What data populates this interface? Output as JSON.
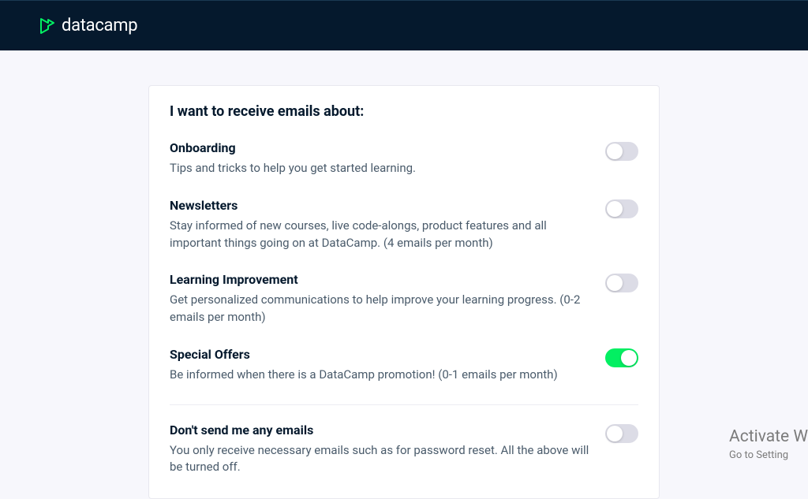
{
  "header": {
    "brand": "datacamp"
  },
  "card": {
    "title": "I want to receive emails about:"
  },
  "prefs": [
    {
      "label": "Onboarding",
      "desc": "Tips and tricks to help you get started learning.",
      "on": false
    },
    {
      "label": "Newsletters",
      "desc": "Stay informed of new courses, live code-alongs, product features and all important things going on at DataCamp. (4 emails per month)",
      "on": false
    },
    {
      "label": "Learning Improvement",
      "desc": "Get personalized communications to help improve your learning progress. (0-2 emails per month)",
      "on": false
    },
    {
      "label": "Special Offers",
      "desc": "Be informed when there is a DataCamp promotion! (0-1 emails per month)",
      "on": true
    }
  ],
  "optout": {
    "label": "Don't send me any emails",
    "desc": "You only receive necessary emails such as for password reset. All the above will be turned off.",
    "on": false
  },
  "watermark": {
    "title": "Activate W",
    "sub": "Go to Setting"
  }
}
